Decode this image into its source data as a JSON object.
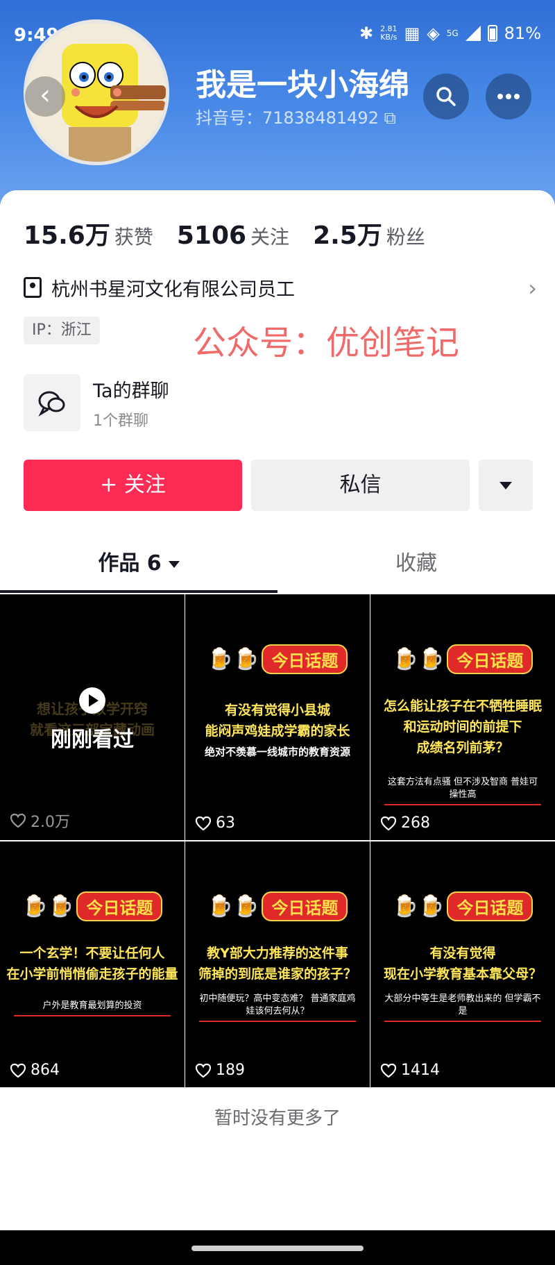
{
  "status_bar": {
    "time": "9:49",
    "net_speed_value": "2.81",
    "net_speed_unit": "KB/s",
    "network": "5G",
    "battery": "81%"
  },
  "profile": {
    "username": "我是一块小海绵",
    "douyin_id": "抖音号：71838481492",
    "stats": [
      {
        "value": "15.6万",
        "label": "获赞"
      },
      {
        "value": "5106",
        "label": "关注"
      },
      {
        "value": "2.5万",
        "label": "粉丝"
      }
    ],
    "company": "杭州书星河文化有限公司员工",
    "ip": "IP：浙江",
    "watermark": "公众号：优创笔记",
    "group": {
      "title": "Ta的群聊",
      "subtitle": "1个群聊"
    }
  },
  "actions": {
    "follow": "+ 关注",
    "message": "私信"
  },
  "tabs": {
    "works": "作品 6",
    "favorites": "收藏"
  },
  "videos": [
    {
      "recent": true,
      "recent_label": "刚刚看过",
      "faded_line1": "想让孩子数学开窍",
      "faded_line2": "就看这三部宝藏动画",
      "likes": "2.0万"
    },
    {
      "topic": "今日话题",
      "line1a": "有没有觉得小县城",
      "line1b": "能闷声鸡娃成学霸的家长",
      "line2": "绝对不羡慕一线城市的教育资源",
      "line3": "",
      "likes": "63"
    },
    {
      "topic": "今日话题",
      "line1a": "怎么能让孩子在不牺牲睡眠",
      "line1b": "和运动时间的前提下",
      "line2": "成绩名列前茅？",
      "line3": "这套方法有点骚 但不涉及智商 普娃可操性高",
      "likes": "268"
    },
    {
      "topic": "今日话题",
      "line1a": "一个玄学！不要让任何人",
      "line1b": "在小学前悄悄偷走孩子的能量",
      "line2": "",
      "line3": "户外是教育最划算的投资",
      "likes": "864"
    },
    {
      "topic": "今日话题",
      "line1a": "教Y部大力推荐的这件事",
      "line1b": "筛掉的到底是谁家的孩子？",
      "line2": "",
      "line3": "初中随便玩？高中变态难？ 普通家庭鸡娃该何去何从？",
      "likes": "189"
    },
    {
      "topic": "今日话题",
      "line1a": "有没有觉得",
      "line1b": "现在小学教育基本靠父母？",
      "line2": "",
      "line3": "大部分中等生是老师教出来的 但学霸不是",
      "likes": "1414"
    }
  ],
  "footer": {
    "no_more": "暂时没有更多了"
  },
  "colors": {
    "accent": "#fe2c55",
    "header_blue": "#3a7de0",
    "topic_red": "#e02a2a",
    "caption_yellow": "#ffe65a"
  }
}
